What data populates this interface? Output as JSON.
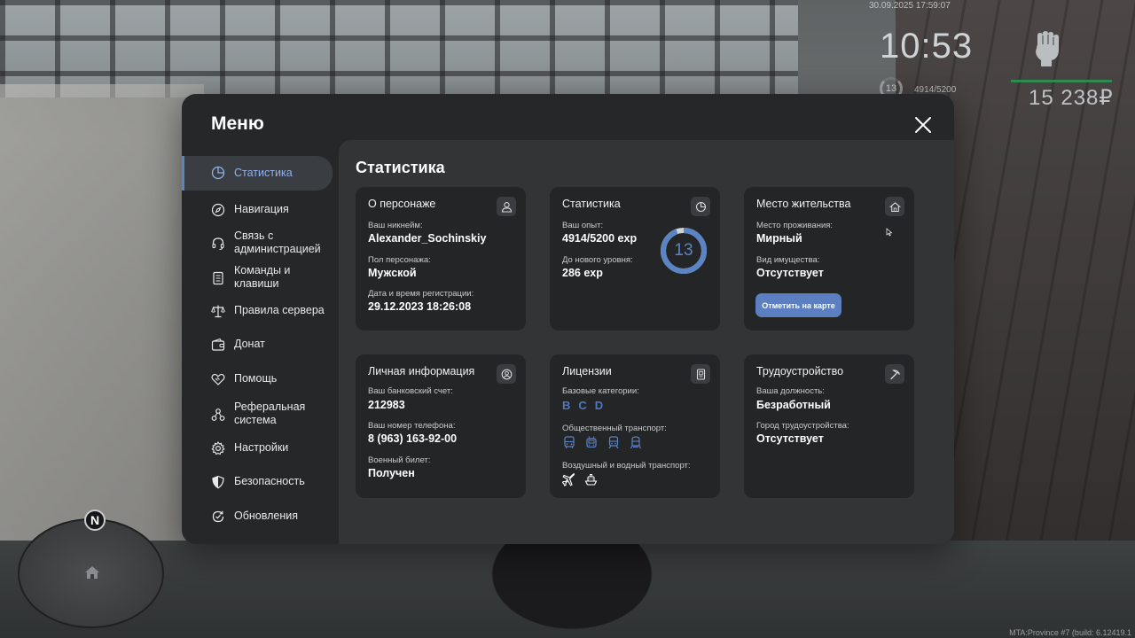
{
  "hud": {
    "datetime": "30.09.2025 17:59:07",
    "clock": "10:53",
    "level": "13",
    "exp": "4914/5200",
    "money": "15 238₽",
    "build": "MTA:Province #7 (build: 6.12419.1"
  },
  "minimap": {
    "north": "N"
  },
  "menu": {
    "title": "Меню",
    "sidebar": [
      {
        "label": "Статистика",
        "icon": "pie-chart-icon",
        "active": true
      },
      {
        "label": "Навигация",
        "icon": "compass-icon"
      },
      {
        "label": "Связь с администрацией",
        "icon": "headset-icon"
      },
      {
        "label": "Команды и клавиши",
        "icon": "keyboard-icon"
      },
      {
        "label": "Правила сервера",
        "icon": "scales-icon"
      },
      {
        "label": "Донат",
        "icon": "wallet-icon"
      },
      {
        "label": "Помощь",
        "icon": "handshake-icon"
      },
      {
        "label": "Реферальная система",
        "icon": "network-icon"
      },
      {
        "label": "Настройки",
        "icon": "gear-icon"
      },
      {
        "label": "Безопасность",
        "icon": "shield-icon"
      },
      {
        "label": "Обновления",
        "icon": "refresh-icon"
      }
    ]
  },
  "content": {
    "title": "Статистика",
    "character": {
      "title": "О персонаже",
      "nickname_label": "Ваш никнейм:",
      "nickname": "Alexander_Sochinskiy",
      "gender_label": "Пол персонажа:",
      "gender": "Мужской",
      "reg_label": "Дата и время регистрации:",
      "reg": "29.12.2023 18:26:08"
    },
    "stats": {
      "title": "Статистика",
      "exp_label": "Ваш опыт:",
      "exp": "4914/5200 exp",
      "next_label": "До нового уровня:",
      "next": "286 exp",
      "level": "13",
      "level_progress": 0.945
    },
    "residence": {
      "title": "Место жительства",
      "place_label": "Место проживания:",
      "place": "Мирный",
      "property_label": "Вид имущества:",
      "property": "Отсутствует",
      "button": "Отметить на карте"
    },
    "personal": {
      "title": "Личная информация",
      "bank_label": "Ваш банковский счет:",
      "bank": "212983",
      "phone_label": "Ваш номер телефона:",
      "phone": "8 (963) 163-92-00",
      "military_label": "Военный билет:",
      "military": "Получен"
    },
    "licenses": {
      "title": "Лицензии",
      "base_label": "Базовые категории:",
      "categories": [
        "B",
        "C",
        "D"
      ],
      "public_label": "Общественный транспорт:",
      "air_label": "Воздушный и водный транспорт:"
    },
    "job": {
      "title": "Трудоустройство",
      "position_label": "Ваша должность:",
      "position": "Безработный",
      "city_label": "Город трудоустройства:",
      "city": "Отсутствует"
    }
  },
  "colors": {
    "accent": "#5b84c4",
    "button": "#5b7fc0",
    "card": "#242527",
    "panel": "#333436",
    "menu": "#262728"
  }
}
